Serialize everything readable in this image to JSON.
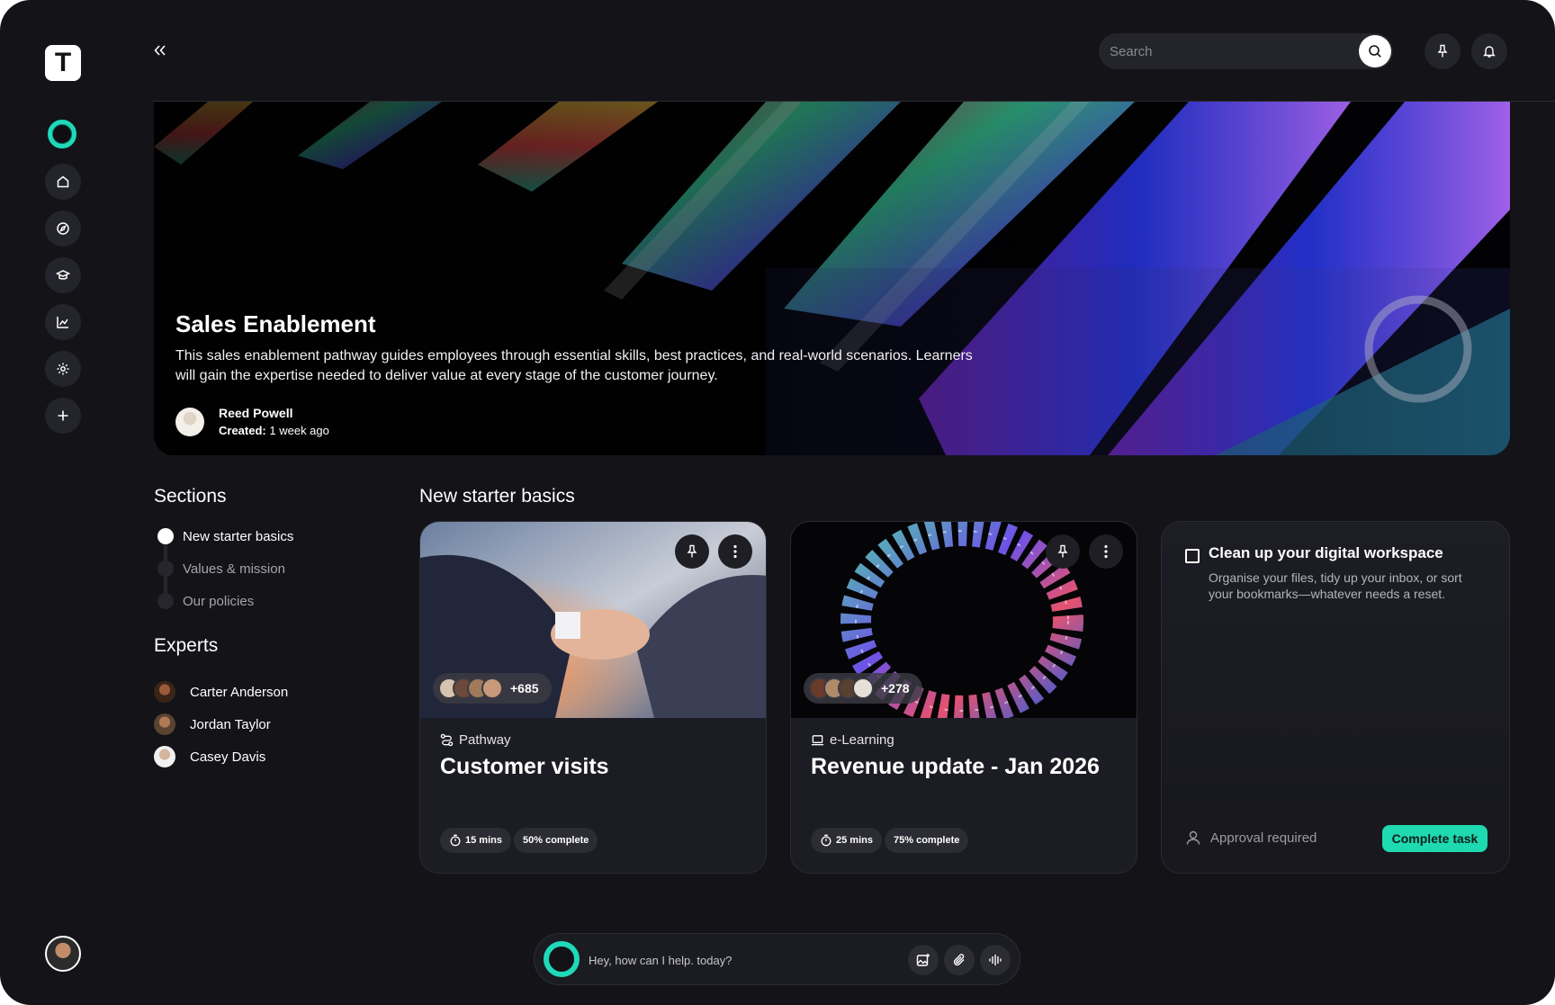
{
  "app": {
    "logo_letter": "T"
  },
  "sidebar": {
    "items": [
      {
        "icon": "home-icon"
      },
      {
        "icon": "compass-icon"
      },
      {
        "icon": "graduation-cap-icon"
      },
      {
        "icon": "chart-icon"
      },
      {
        "icon": "gear-icon"
      },
      {
        "icon": "plus-icon"
      }
    ]
  },
  "header": {
    "search_placeholder": "Search"
  },
  "hero": {
    "title": "Sales Enablement",
    "description": "This sales enablement pathway guides employees through essential skills, best practices, and real-world scenarios. Learners will gain the expertise needed to deliver value at every stage of the customer journey.",
    "author": "Reed Powell",
    "created_label": "Created:",
    "created_value": "1 week ago"
  },
  "sections": {
    "title": "Sections",
    "items": [
      {
        "label": "New starter basics",
        "active": true
      },
      {
        "label": "Values & mission",
        "active": false
      },
      {
        "label": "Our policies",
        "active": false
      }
    ]
  },
  "experts": {
    "title": "Experts",
    "items": [
      {
        "name": "Carter Anderson"
      },
      {
        "name": "Jordan Taylor"
      },
      {
        "name": "Casey Davis"
      }
    ]
  },
  "main": {
    "title": "New starter basics",
    "cards": [
      {
        "type": "Pathway",
        "title": "Customer visits",
        "learners": "+685",
        "duration": "15 mins",
        "progress_label": "50% complete",
        "progress": 0.5
      },
      {
        "type": "e-Learning",
        "title": "Revenue update - Jan 2026",
        "learners": "+278",
        "duration": "25 mins",
        "progress_label": "75% complete",
        "progress": 0.75
      }
    ],
    "task": {
      "title": "Clean up your digital workspace",
      "description": "Organise your files, tidy up your inbox, or sort your bookmarks—whatever needs a reset.",
      "status": "Approval required",
      "action": "Complete task"
    }
  },
  "assistant": {
    "placeholder": "Hey, how can I help. today?"
  },
  "colors": {
    "background": "#131318",
    "accent": "#1fd9b0",
    "card": "#1c1c24"
  }
}
